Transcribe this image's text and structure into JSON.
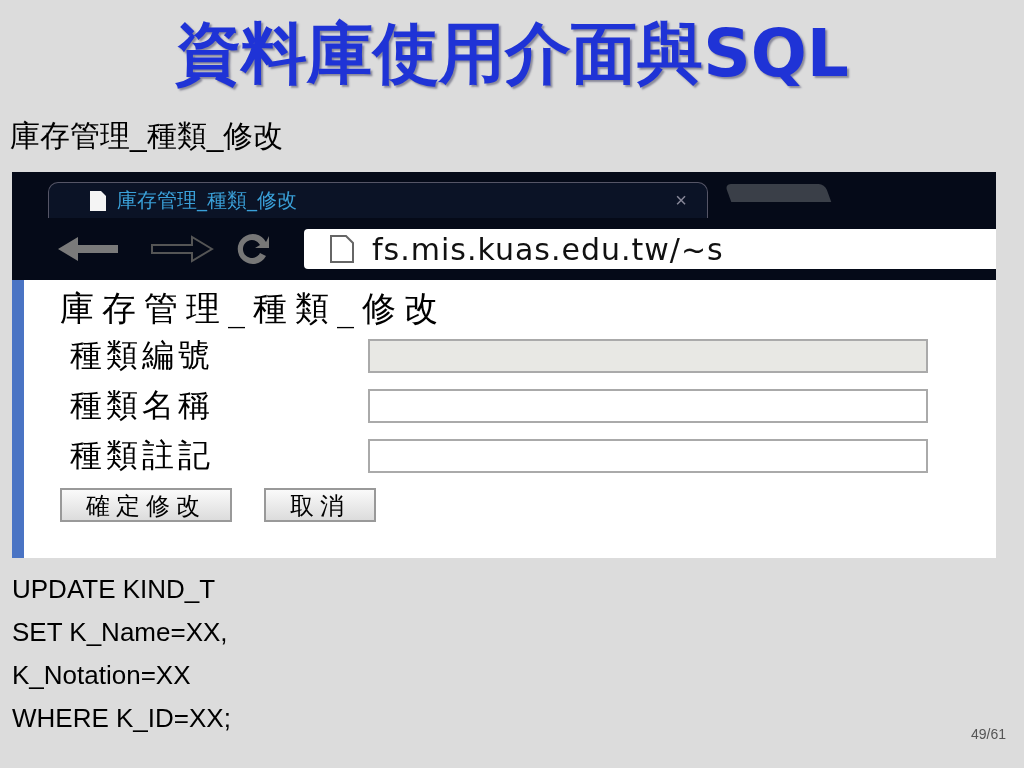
{
  "slide": {
    "title": "資料庫使用介面與SQL",
    "subtitle": "庫存管理_種類_修改",
    "page_number": "49/61"
  },
  "browser": {
    "tab_title": "庫存管理_種類_修改",
    "tab_close": "×",
    "address": "fs.mis.kuas.edu.tw/~s"
  },
  "form": {
    "heading": "庫存管理_種類_修改",
    "fields": [
      {
        "label": "種類編號",
        "disabled": true
      },
      {
        "label": "種類名稱",
        "disabled": false
      },
      {
        "label": "種類註記",
        "disabled": false
      }
    ],
    "buttons": [
      "確定修改",
      "取消"
    ]
  },
  "sql_lines": [
    "UPDATE KIND_T",
    "SET K_Name=XX,",
    "K_Notation=XX",
    "WHERE K_ID=XX;"
  ]
}
